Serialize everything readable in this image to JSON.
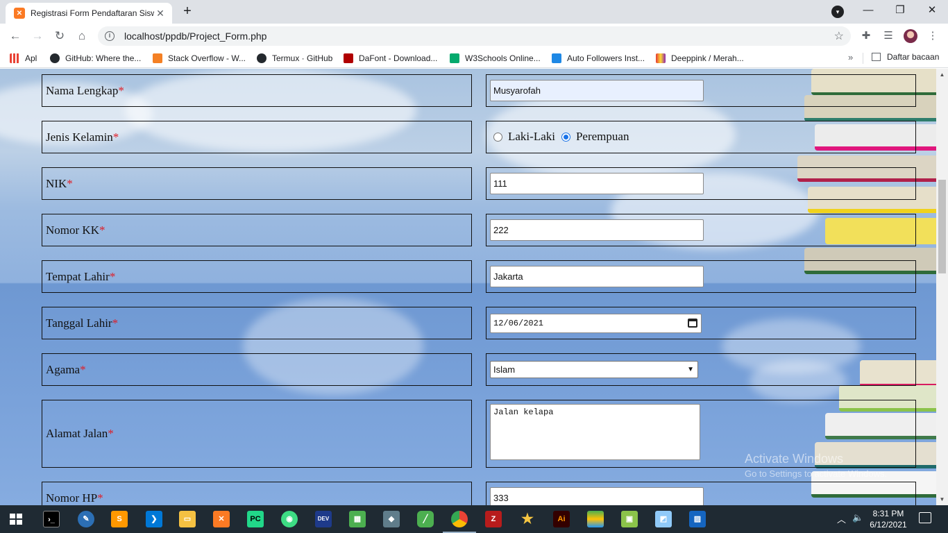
{
  "browser": {
    "tab_title": "Registrasi Form Pendaftaran Siswa",
    "url": "localhost/ppdb/Project_Form.php",
    "window_controls": {
      "minimize": "—",
      "restore": "❐",
      "close": "✕"
    }
  },
  "bookmarks": [
    {
      "label": "Apl",
      "color": "#e94235"
    },
    {
      "label": "GitHub: Where the...",
      "color": "#24292e"
    },
    {
      "label": "Stack Overflow - W...",
      "color": "#f48024"
    },
    {
      "label": "Termux · GitHub",
      "color": "#24292e"
    },
    {
      "label": "DaFont - Download...",
      "color": "#b00000"
    },
    {
      "label": "W3Schools Online...",
      "color": "#04aa6d"
    },
    {
      "label": "Auto Followers Inst...",
      "color": "#1e88e5"
    },
    {
      "label": "Deeppink / Merah...",
      "color": "#8e24aa"
    }
  ],
  "reading_list": "Daftar bacaan",
  "form": {
    "nama": {
      "label": "Nama Lengkap",
      "value": "Musyarofah"
    },
    "jenis_kelamin": {
      "label": "Jenis Kelamin",
      "option1": "Laki-Laki",
      "option2": "Perempuan",
      "selected": "Perempuan"
    },
    "nik": {
      "label": "NIK",
      "value": "111"
    },
    "nomor_kk": {
      "label": "Nomor KK",
      "value": "222"
    },
    "tempat_lahir": {
      "label": "Tempat Lahir",
      "value": "Jakarta"
    },
    "tanggal_lahir": {
      "label": "Tanggal Lahir",
      "value": "12/06/2021"
    },
    "agama": {
      "label": "Agama",
      "value": "Islam"
    },
    "alamat": {
      "label": "Alamat Jalan",
      "value": "Jalan kelapa"
    },
    "nomor_hp": {
      "label": "Nomor HP",
      "value": "333"
    },
    "required_mark": "*"
  },
  "watermark": {
    "line1": "Activate Windows",
    "line2": "Go to Settings to activate Windows."
  },
  "taskbar": {
    "time": "8:31 PM",
    "date": "6/12/2021"
  },
  "colors": {
    "required": "#e01b24",
    "accent": "#1a73e8"
  }
}
